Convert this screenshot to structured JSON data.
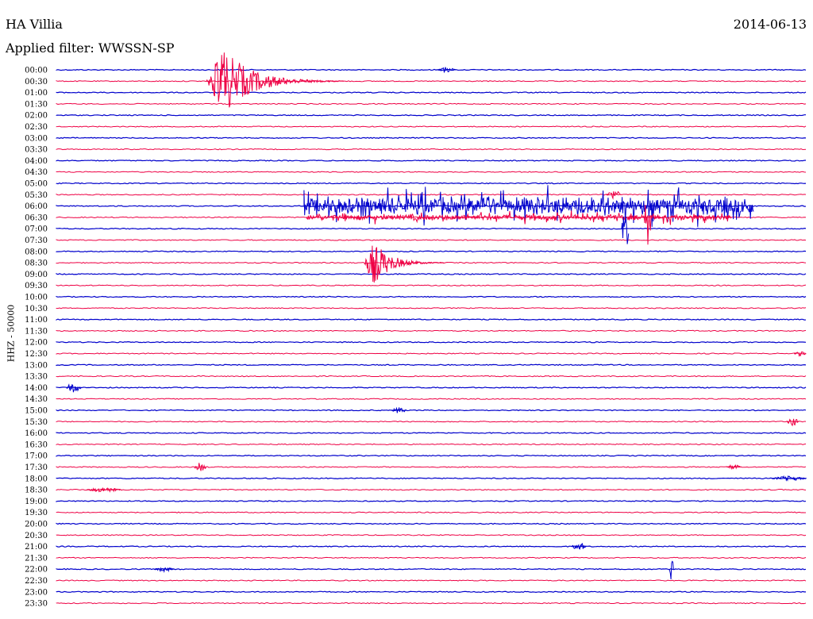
{
  "header": {
    "station": "HA Villia",
    "date": "2014-06-13",
    "filter": "Applied filter: WWSSN-SP"
  },
  "chart_data": {
    "type": "line",
    "title": "HA Villia",
    "date": "2014-06-13",
    "filter": "WWSSN-SP",
    "ylabel": "HHZ - 50000",
    "row_labels": [
      "00:00",
      "00:30",
      "01:00",
      "01:30",
      "02:00",
      "02:30",
      "03:00",
      "03:30",
      "04:00",
      "04:30",
      "05:00",
      "05:30",
      "06:00",
      "06:30",
      "07:00",
      "07:30",
      "08:00",
      "08:30",
      "09:00",
      "09:30",
      "10:00",
      "10:30",
      "11:00",
      "11:30",
      "12:00",
      "12:30",
      "13:00",
      "13:30",
      "14:00",
      "14:30",
      "15:00",
      "15:30",
      "16:00",
      "16:30",
      "17:00",
      "17:30",
      "18:00",
      "18:30",
      "19:00",
      "19:30",
      "20:00",
      "20:30",
      "21:00",
      "21:30",
      "22:00",
      "22:30",
      "23:00",
      "23:30"
    ],
    "row_minutes": 30,
    "colors": {
      "even": "#0000cc",
      "odd": "#ee0044"
    },
    "events": [
      {
        "row": "00:30",
        "start_min": 6.0,
        "peak_amp": 42,
        "duration_min": 5.5,
        "kind": "earthquake"
      },
      {
        "row": "00:00",
        "start_min": 15.2,
        "peak_amp": 4,
        "duration_min": 0.8,
        "kind": "spike"
      },
      {
        "row": "08:30",
        "start_min": 12.3,
        "peak_amp": 28,
        "duration_min": 3.2,
        "kind": "earthquake"
      },
      {
        "row": "06:00",
        "start_min": 9.9,
        "peak_amp": 30,
        "duration_min": 18,
        "kind": "swarm"
      },
      {
        "row": "06:30",
        "start_min": 10.0,
        "peak_amp": 10,
        "duration_min": 17,
        "kind": "swarm"
      },
      {
        "row": "05:30",
        "start_min": 22.0,
        "peak_amp": 6,
        "duration_min": 0.6,
        "kind": "spike"
      },
      {
        "row": "06:30",
        "start_min": 23.5,
        "peak_amp": 38,
        "duration_min": 0.3,
        "kind": "spike"
      },
      {
        "row": "07:00",
        "start_min": 22.6,
        "peak_amp": 30,
        "duration_min": 0.3,
        "kind": "spike"
      },
      {
        "row": "14:00",
        "start_min": 0.4,
        "peak_amp": 7,
        "duration_min": 0.6,
        "kind": "spike"
      },
      {
        "row": "15:00",
        "start_min": 13.4,
        "peak_amp": 4,
        "duration_min": 0.6,
        "kind": "spike"
      },
      {
        "row": "15:30",
        "start_min": 29.2,
        "peak_amp": 5,
        "duration_min": 0.5,
        "kind": "spike"
      },
      {
        "row": "17:30",
        "start_min": 5.5,
        "peak_amp": 8,
        "duration_min": 0.5,
        "kind": "spike"
      },
      {
        "row": "17:30",
        "start_min": 26.8,
        "peak_amp": 3,
        "duration_min": 0.6,
        "kind": "spike"
      },
      {
        "row": "21:00",
        "start_min": 20.6,
        "peak_amp": 5,
        "duration_min": 0.6,
        "kind": "spike"
      },
      {
        "row": "22:00",
        "start_min": 24.5,
        "peak_amp": 15,
        "duration_min": 0.2,
        "kind": "spike"
      },
      {
        "row": "22:00",
        "start_min": 3.9,
        "peak_amp": 3,
        "duration_min": 0.8,
        "kind": "spike"
      },
      {
        "row": "18:30",
        "start_min": 1.2,
        "peak_amp": 3,
        "duration_min": 1.4,
        "kind": "spike"
      },
      {
        "row": "18:00",
        "start_min": 28.6,
        "peak_amp": 3,
        "duration_min": 1.5,
        "kind": "spike"
      },
      {
        "row": "12:30",
        "start_min": 29.5,
        "peak_amp": 3,
        "duration_min": 0.5,
        "kind": "spike"
      }
    ]
  }
}
